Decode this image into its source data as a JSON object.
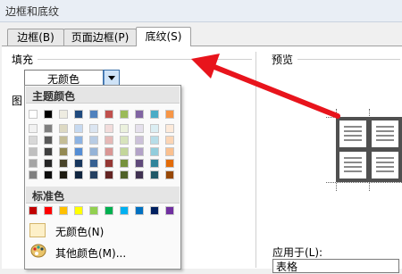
{
  "window": {
    "title": "边框和底纹"
  },
  "tabs": [
    {
      "label": "边框(B)",
      "selected": false
    },
    {
      "label": "页面边框(P)",
      "selected": false
    },
    {
      "label": "底纹(S)",
      "selected": true
    }
  ],
  "fill": {
    "group_label": "填充",
    "selected_value": "无颜色",
    "left_stub": "图"
  },
  "preview": {
    "label": "预览"
  },
  "apply": {
    "label": "应用于(L):",
    "value": "表格"
  },
  "palette": {
    "theme_header": "主题颜色",
    "standard_header": "标准色",
    "theme_top_row": [
      "#ffffff",
      "#000000",
      "#eeece1",
      "#1f497d",
      "#4f81bd",
      "#c0504d",
      "#9bbb59",
      "#8064a2",
      "#4bacc6",
      "#f79646"
    ],
    "theme_shades": [
      [
        "#f2f2f2",
        "#7f7f7f",
        "#ddd9c3",
        "#c6d9f0",
        "#dbe5f1",
        "#f2dcdb",
        "#ebf1dd",
        "#e5e0ec",
        "#dbeef3",
        "#fdeada"
      ],
      [
        "#d8d8d8",
        "#595959",
        "#c4bd97",
        "#8db3e2",
        "#b8cce4",
        "#e5b9b7",
        "#d7e3bc",
        "#ccc1d9",
        "#b7dde8",
        "#fbd5b5"
      ],
      [
        "#bfbfbf",
        "#3f3f3f",
        "#938953",
        "#548dd4",
        "#95b3d7",
        "#d99694",
        "#c3d69b",
        "#b2a2c7",
        "#92cddc",
        "#fac08f"
      ],
      [
        "#a5a5a5",
        "#262626",
        "#494429",
        "#17365d",
        "#366092",
        "#953734",
        "#76923c",
        "#5f497a",
        "#31859b",
        "#e36c09"
      ],
      [
        "#7f7f7f",
        "#0c0c0c",
        "#1d1b10",
        "#0f243e",
        "#244061",
        "#632423",
        "#4f6128",
        "#3f3151",
        "#205867",
        "#974806"
      ]
    ],
    "standard_colors": [
      "#c00000",
      "#ff0000",
      "#ffc000",
      "#ffff00",
      "#92d050",
      "#00b050",
      "#00b0f0",
      "#0070c0",
      "#002060",
      "#7030a0"
    ],
    "no_color_label": "无颜色(N)",
    "more_colors_label": "其他颜色(M)..."
  },
  "annotation": {
    "arrow_color": "#e8141c"
  }
}
